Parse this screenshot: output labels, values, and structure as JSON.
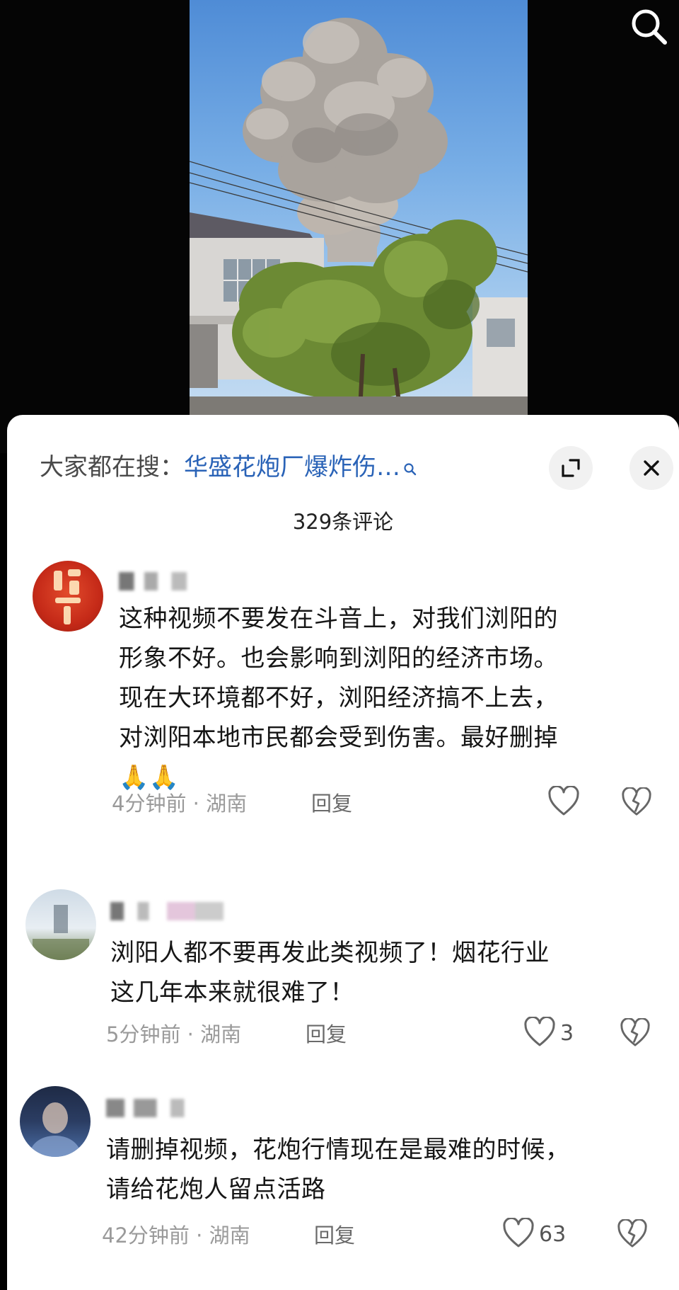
{
  "top_bar": {
    "search_icon": "search-icon"
  },
  "sheet": {
    "hot_search": {
      "prefix": "大家都在搜：",
      "term": "华盛花炮厂爆炸伤…",
      "icon": "search-icon"
    },
    "buttons": {
      "expand_icon": "expand-icon",
      "close_icon": "close-icon"
    },
    "comment_count": "329条评论",
    "comments": [
      {
        "lines": [
          "这种视频不要发在斗音上，对我们浏阳的",
          "形象不好。也会影响到浏阳的经济市场。",
          "现在大环境都不好，浏阳经济搞不上去，",
          "对浏阳本地市民都会受到伤害。最好删掉"
        ],
        "emoji": "🙏🙏",
        "time": "4分钟前",
        "location": "湖南",
        "reply": "回复",
        "likes": ""
      },
      {
        "lines": [
          "浏阳人都不要再发此类视频了！烟花行业",
          "这几年本来就很难了！"
        ],
        "time": "5分钟前",
        "location": "湖南",
        "reply": "回复",
        "likes": "3"
      },
      {
        "lines": [
          "请删掉视频，花炮行情现在是最难的时候，",
          "请给花炮人留点活路"
        ],
        "time": "42分钟前",
        "location": "湖南",
        "reply": "回复",
        "likes": "63"
      }
    ]
  },
  "colors": {
    "link_blue": "#2a63b7",
    "meta_gray": "#9a9a9a",
    "sheet_bg": "#ffffff"
  }
}
